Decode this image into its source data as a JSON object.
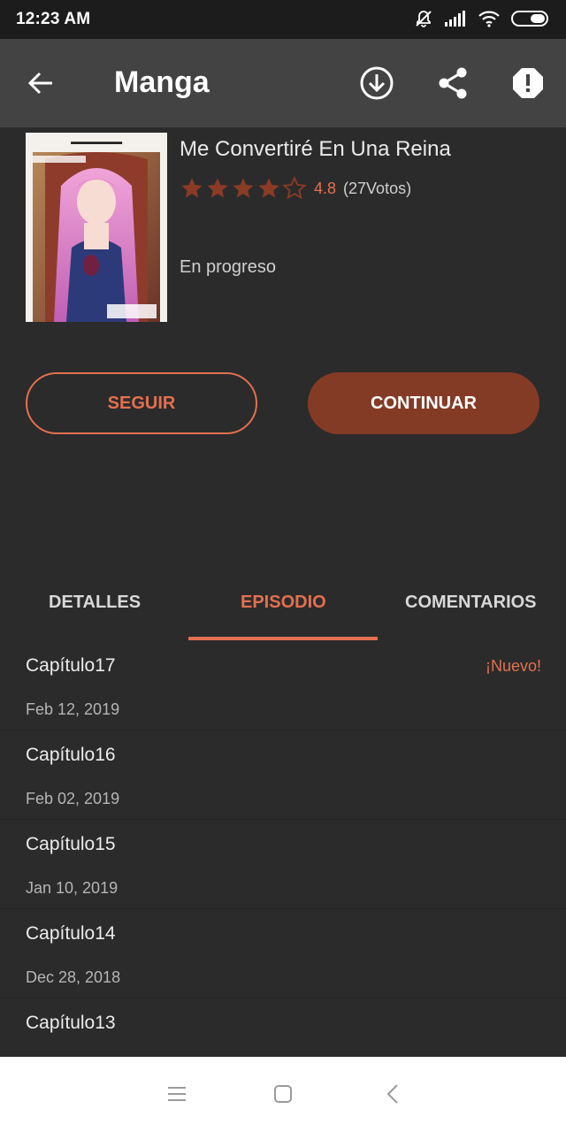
{
  "status_bar": {
    "time": "12:23 AM",
    "icons": [
      "mute-icon",
      "signal-icon",
      "wifi-icon",
      "battery-icon"
    ]
  },
  "app_bar": {
    "title": "Manga",
    "icons": [
      "back-arrow-icon",
      "download-icon",
      "share-icon",
      "report-icon"
    ]
  },
  "manga": {
    "title": "Me Convertiré En Una Reina",
    "rating_stars": 4,
    "rating_max": 5,
    "score": "4.8",
    "votes": "(27Votos)",
    "status": "En progreso",
    "cover_alt": "manga-cover"
  },
  "actions": {
    "follow_label": "SEGUIR",
    "continue_label": "CONTINUAR"
  },
  "tabs": [
    {
      "label": "DETALLES"
    },
    {
      "label": "EPISODIO",
      "active": true
    },
    {
      "label": "COMENTARIOS"
    }
  ],
  "episodes": [
    {
      "title": "Capítulo17",
      "date": "Feb 12, 2019",
      "badge": "¡Nuevo!"
    },
    {
      "title": "Capítulo16",
      "date": "Feb 02, 2019"
    },
    {
      "title": "Capítulo15",
      "date": "Jan 10, 2019"
    },
    {
      "title": "Capítulo14",
      "date": "Dec 28, 2018"
    },
    {
      "title": "Capítulo13",
      "date": ""
    }
  ],
  "colors": {
    "accent": "#e3704f",
    "button_fill": "#843b25",
    "background": "#2b2b2b",
    "app_bar": "#434343"
  }
}
